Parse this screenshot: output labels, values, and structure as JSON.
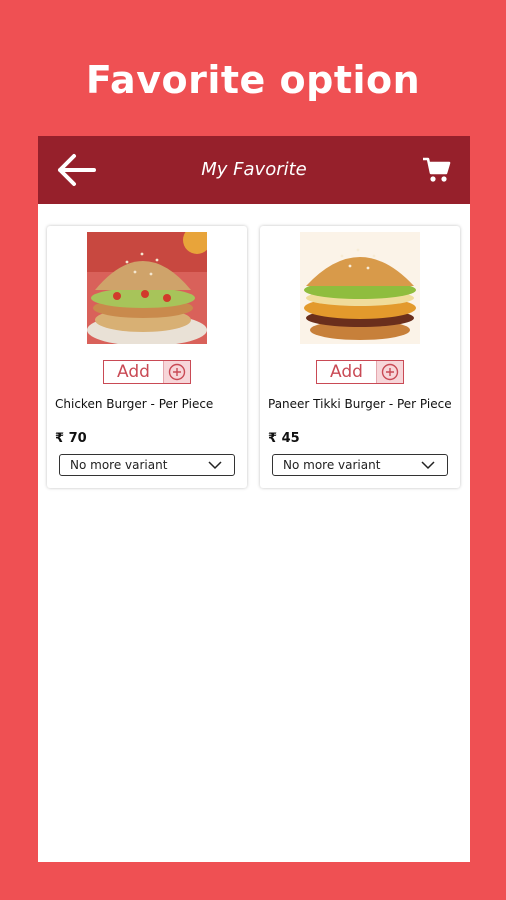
{
  "promo": {
    "title": "Favorite option"
  },
  "appbar": {
    "title": "My Favorite",
    "back_icon": "arrow-left",
    "cart_icon": "shopping-cart"
  },
  "colors": {
    "background": "#ef5053",
    "appbar": "#96202b",
    "accent": "#c94a55"
  },
  "products": [
    {
      "name": "Chicken Burger - Per Piece",
      "price": "₹ 70",
      "add_label": "Add",
      "variant": "No more variant"
    },
    {
      "name": "Paneer Tikki Burger - Per Piece",
      "price": "₹ 45",
      "add_label": "Add",
      "variant": "No more variant"
    }
  ]
}
